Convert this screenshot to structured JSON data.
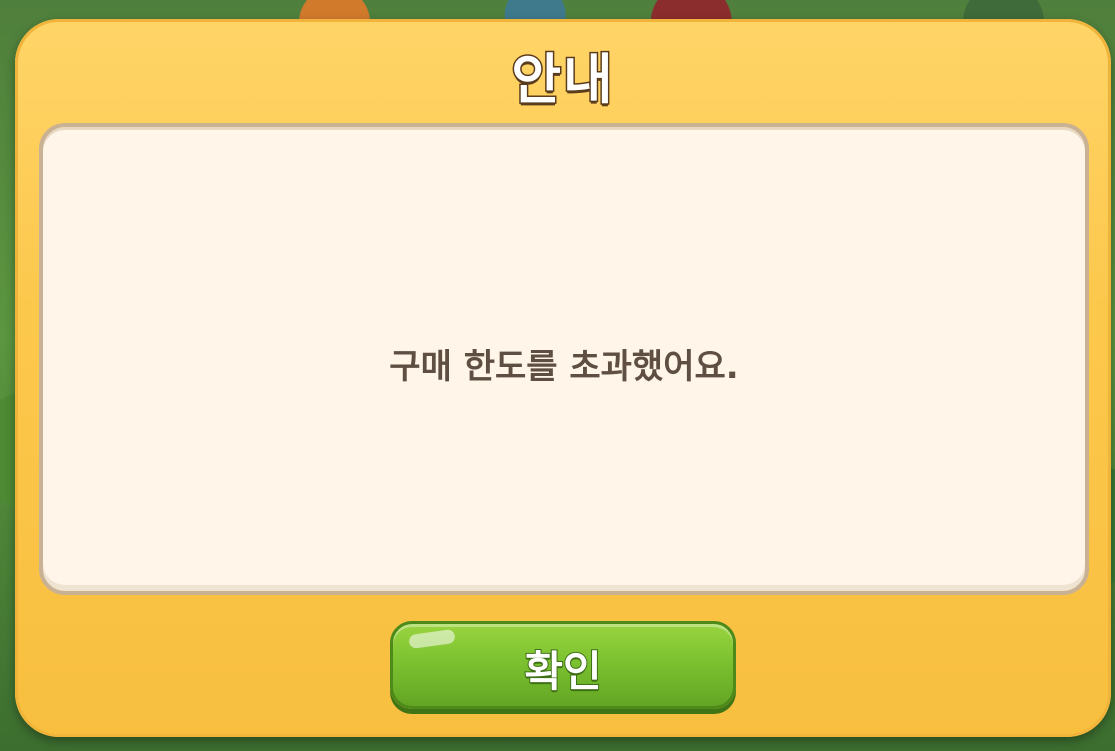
{
  "dialog": {
    "title": "안내",
    "message": "구매 한도를 초과했어요.",
    "confirm_label": "확인"
  },
  "colors": {
    "dialog_frame": "#fcc84c",
    "panel_background": "#fff5e8",
    "message_text": "#5e4f42",
    "confirm_button": "#7cc230"
  }
}
